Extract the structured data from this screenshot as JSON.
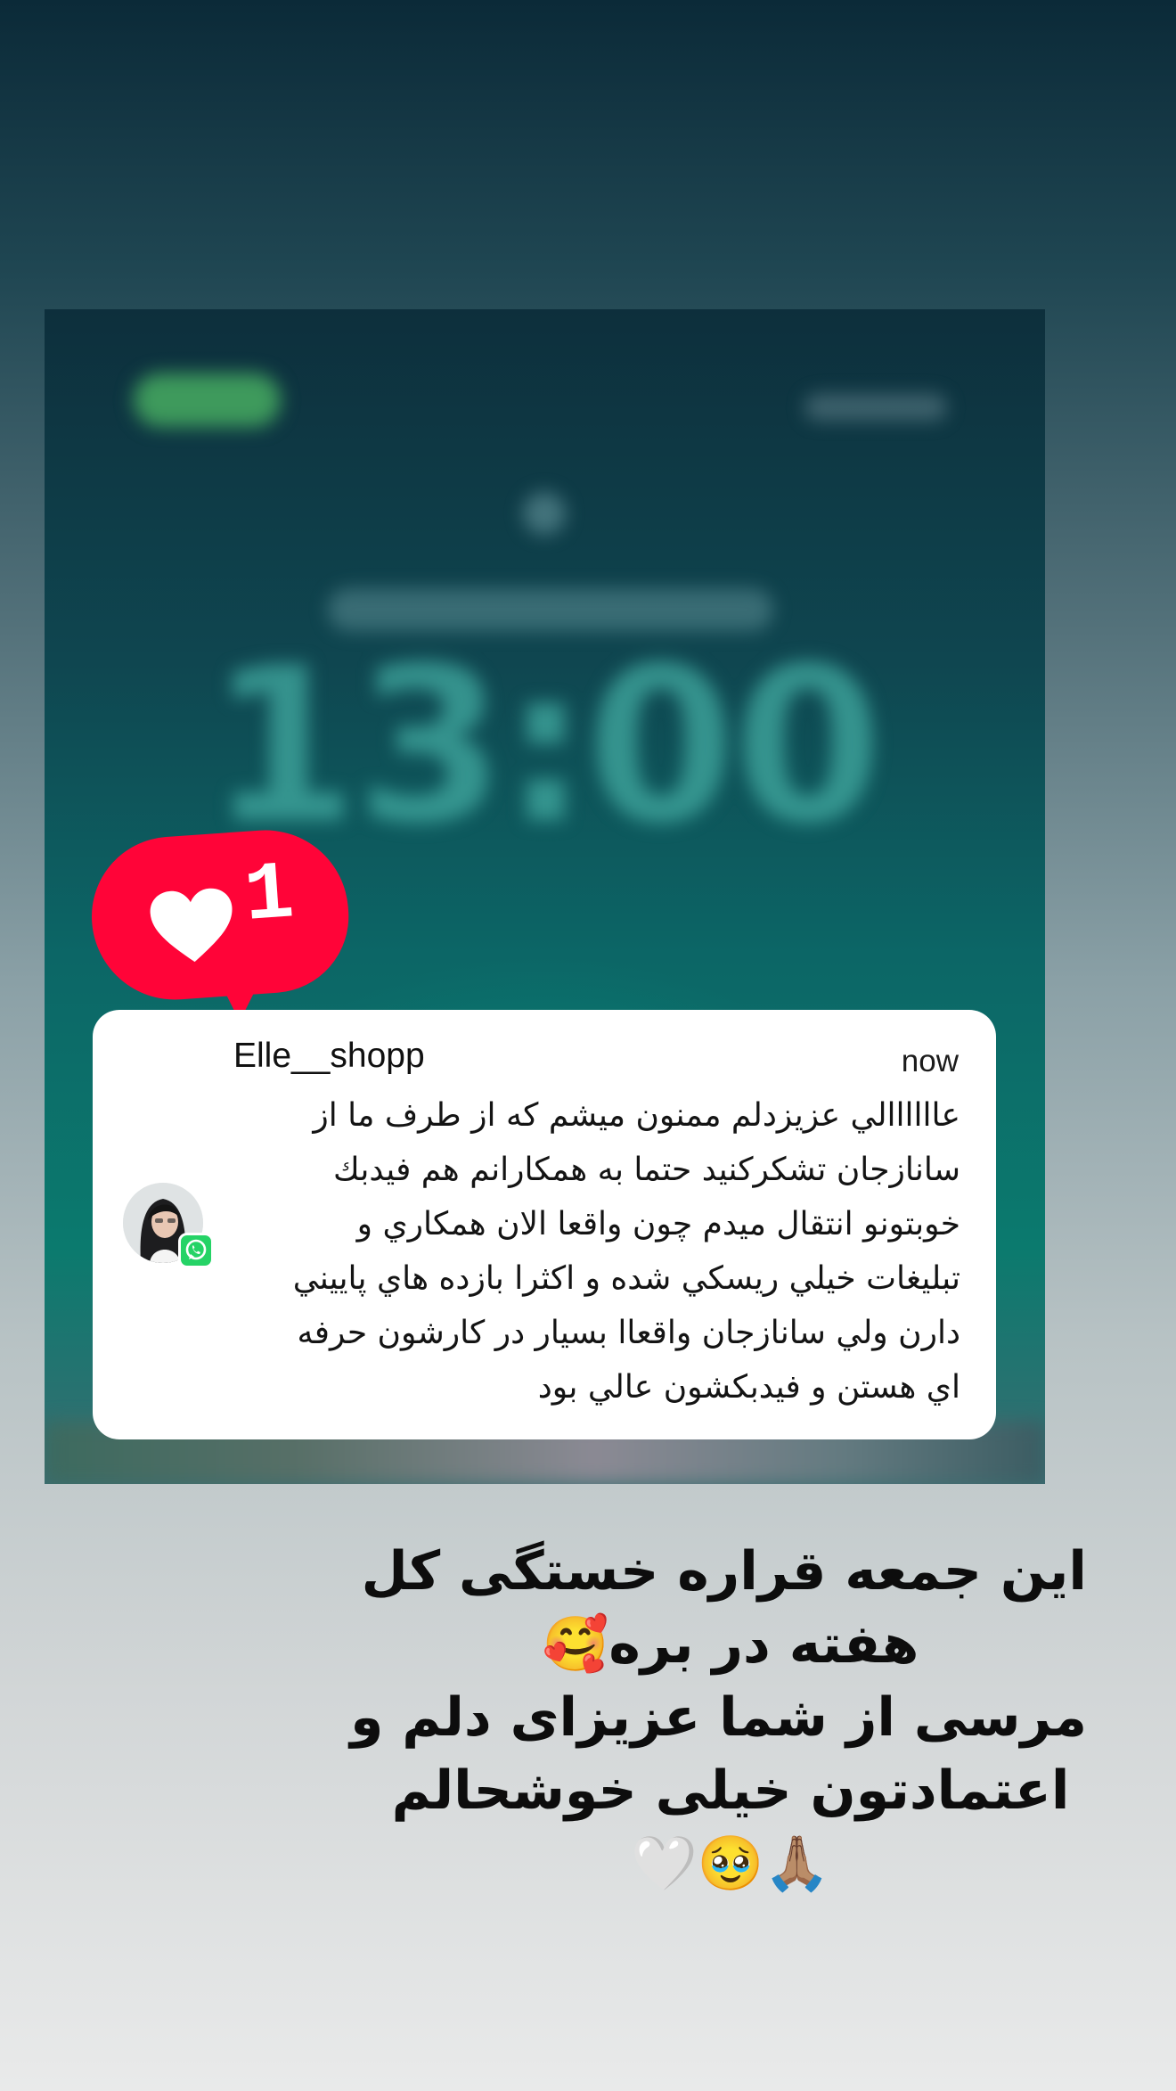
{
  "story": {
    "blurred_background_time": "13:00",
    "like_bubble": {
      "count": "1",
      "icon": "heart-icon",
      "color": "#ff0438"
    },
    "notification": {
      "sender": "Elle__shopp",
      "time": "now",
      "app_badge_icon": "whatsapp-icon",
      "message_lines": [
        "عاااااالي عزيزدلم ممنون ميشم كه از طرف ما از",
        "سانازجان تشكركنيد حتما به همكارانم هم فيدبك",
        "خوبتونو انتقال ميدم چون واقعا الان همكاري و",
        "تبليغات خيلي ريسكي شده و اكثرا بازده هاي پاييني",
        "دارن ولي سانازجان واقعاا بسيار در كارشون حرفه",
        "اي هستن و فيدبكشون عالي بود"
      ]
    },
    "caption_lines": [
      "این جمعه قراره خستگی کل",
      "هفته در بره🥰",
      "مرسی از شما عزیزای دلم و",
      "اعتمادتون خیلی خوشحالم",
      "🙏🏽🥹🤍"
    ]
  }
}
